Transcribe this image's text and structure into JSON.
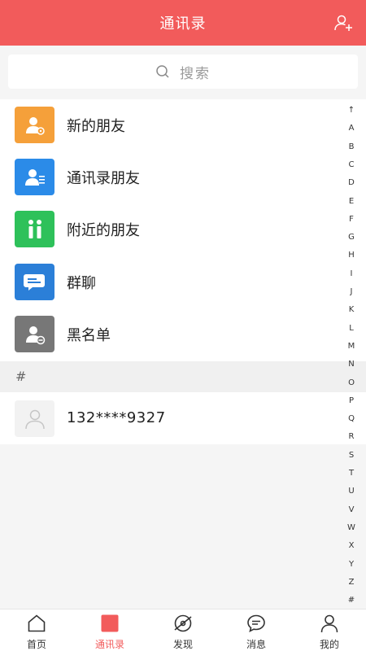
{
  "header": {
    "title": "通讯录",
    "add_friend_icon": "add-user-icon",
    "bg_color": "#f25b5b"
  },
  "search": {
    "placeholder": "搜索",
    "icon": "search-icon"
  },
  "menu_items": [
    {
      "label": "新的朋友",
      "icon": "new-friend-icon",
      "color": "#f5a03a"
    },
    {
      "label": "通讯录朋友",
      "icon": "contacts-icon",
      "color": "#2b8be8"
    },
    {
      "label": "附近的朋友",
      "icon": "nearby-icon",
      "color": "#2ec15a"
    },
    {
      "label": "群聊",
      "icon": "group-chat-icon",
      "color": "#2b7fd8"
    },
    {
      "label": "黑名单",
      "icon": "blacklist-icon",
      "color": "#777777"
    }
  ],
  "section": {
    "label": "#"
  },
  "contacts": [
    {
      "name": "132****9327",
      "avatar": "default-avatar-icon"
    }
  ],
  "index_letters": [
    "↑",
    "A",
    "B",
    "C",
    "D",
    "E",
    "F",
    "G",
    "H",
    "I",
    "J",
    "K",
    "L",
    "M",
    "N",
    "O",
    "P",
    "Q",
    "R",
    "S",
    "T",
    "U",
    "V",
    "W",
    "X",
    "Y",
    "Z",
    "#"
  ],
  "tabbar": {
    "active_color": "#f25b5b",
    "tabs": [
      {
        "label": "首页",
        "icon": "home-icon",
        "active": false
      },
      {
        "label": "通讯录",
        "icon": "contacts-tab-icon",
        "active": true
      },
      {
        "label": "发现",
        "icon": "discover-icon",
        "active": false
      },
      {
        "label": "消息",
        "icon": "message-icon",
        "active": false
      },
      {
        "label": "我的",
        "icon": "profile-icon",
        "active": false
      }
    ]
  }
}
